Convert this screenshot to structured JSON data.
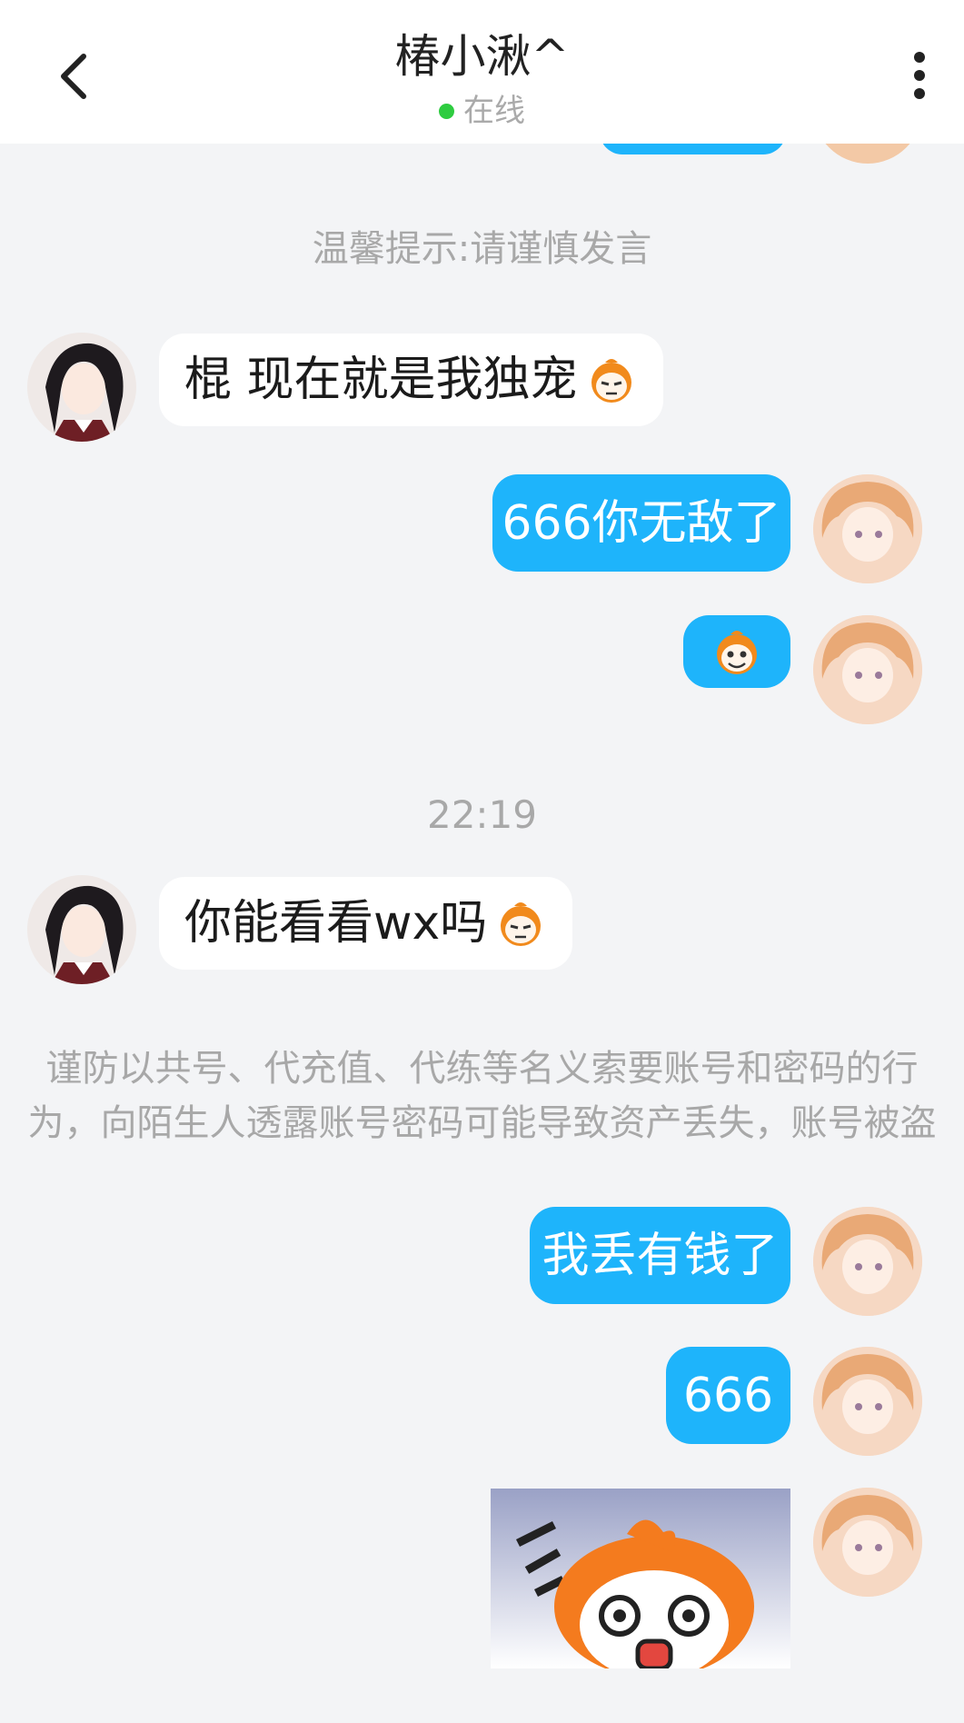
{
  "header": {
    "title": "椿小湫^",
    "status": "在线"
  },
  "notices": {
    "warm_tip": "温馨提示:请谨慎发言",
    "fraud_warning_line1": "谨防以共号、代充值、代练等名义索要账号和密码的行",
    "fraud_warning_line2": "为，向陌生人透露账号密码可能导致资产丢失，账号被盗"
  },
  "timestamp": "22:19",
  "messages": [
    {
      "side": "in",
      "text": "棍 现在就是我独宠",
      "emoji": "monkey-sideeye-emoji"
    },
    {
      "side": "out",
      "text": "666你无敌了"
    },
    {
      "side": "out",
      "text": "",
      "emoji": "monkey-grin-emoji"
    },
    {
      "side": "in",
      "text": "你能看看wx吗",
      "emoji": "monkey-sideeye-emoji"
    },
    {
      "side": "out",
      "text": "我丢有钱了"
    },
    {
      "side": "out",
      "text": "666"
    },
    {
      "side": "out",
      "text": "",
      "sticker": "shocked-monkey-sticker"
    }
  ],
  "colors": {
    "outgoing_bubble": "#1eb4fb",
    "incoming_bubble": "#ffffff",
    "background": "#f3f4f6",
    "online_dot": "#2ecc40"
  }
}
